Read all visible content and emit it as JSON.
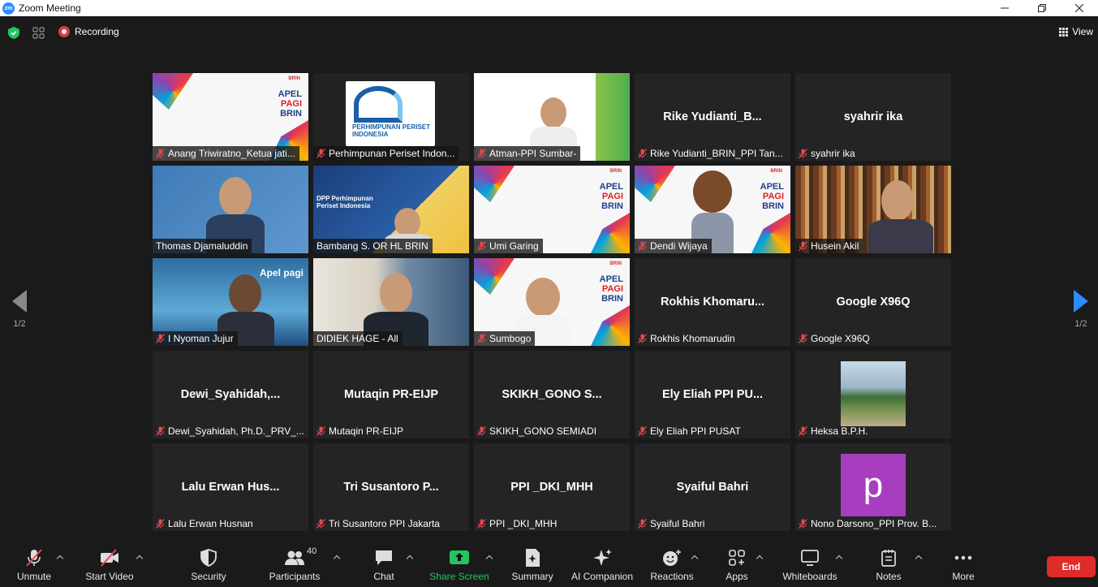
{
  "window": {
    "title": "Zoom Meeting",
    "logo_text": "zm"
  },
  "topbar": {
    "recording_label": "Recording",
    "view_label": "View"
  },
  "pager": {
    "left": "1/2",
    "right": "1/2"
  },
  "tiles": [
    {
      "name": "Anang Triwiratno_Ketua jati...",
      "kind": "apel",
      "muted": true
    },
    {
      "name": "Perhimpunan Periset Indon...",
      "kind": "ppi",
      "muted": true
    },
    {
      "name": "Atman-PPI Sumbar-",
      "kind": "sumbar",
      "muted": true
    },
    {
      "name": "Rike Yudianti_BRIN_PPI Tan...",
      "kind": "text",
      "display": "Rike  Yudianti_B...",
      "muted": true
    },
    {
      "name": "syahrir ika",
      "kind": "text",
      "display": "syahrir ika",
      "muted": true
    },
    {
      "name": "Thomas Djamaluddin",
      "kind": "thomas",
      "muted": false
    },
    {
      "name": "Bambang S. OR HL BRIN",
      "kind": "bambang",
      "muted": false
    },
    {
      "name": "Umi Garing",
      "kind": "apel",
      "muted": true
    },
    {
      "name": "Dendi Wijaya",
      "kind": "dendi",
      "muted": true
    },
    {
      "name": "Husein Akil",
      "kind": "husein",
      "muted": true
    },
    {
      "name": "I Nyoman Jujur",
      "kind": "nyoman",
      "muted": true
    },
    {
      "name": "DIDIEK HAGE - All",
      "kind": "didiek",
      "muted": false,
      "active": true
    },
    {
      "name": "Sumbogo",
      "kind": "sumbogo",
      "muted": true
    },
    {
      "name": "Rokhis Khomarudin",
      "kind": "text",
      "display": "Rokhis  Khomaru...",
      "muted": true
    },
    {
      "name": "Google X96Q",
      "kind": "text",
      "display": "Google X96Q",
      "muted": true
    },
    {
      "name": "Dewi_Syahidah, Ph.D._PRV_...",
      "kind": "text",
      "display": "Dewi_Syahidah,...",
      "muted": true
    },
    {
      "name": "Mutaqin PR-EIJP",
      "kind": "text",
      "display": "Mutaqin PR-EIJP",
      "muted": true
    },
    {
      "name": "SKIKH_GONO SEMIADI",
      "kind": "text",
      "display": "SKIKH_GONO  S...",
      "muted": true
    },
    {
      "name": "Ely Eliah  PPI PUSAT",
      "kind": "text",
      "display": "Ely Eliah   PPI PU...",
      "muted": true
    },
    {
      "name": "Heksa B.P.H.",
      "kind": "photo",
      "muted": true
    },
    {
      "name": "Lalu Erwan Husnan",
      "kind": "text",
      "display": "Lalu  Erwan Hus...",
      "muted": true
    },
    {
      "name": "Tri Susantoro PPI Jakarta",
      "kind": "text",
      "display": "Tri Susantoro  P...",
      "muted": true
    },
    {
      "name": "PPI _DKI_MHH",
      "kind": "text",
      "display": "PPI _DKI_MHH",
      "muted": true
    },
    {
      "name": "Syaiful Bahri",
      "kind": "text",
      "display": "Syaiful Bahri",
      "muted": true
    },
    {
      "name": "Nono Darsono_PPI Prov. B...",
      "kind": "avatar",
      "avatar_letter": "p",
      "muted": true
    }
  ],
  "tile_art": {
    "apel_line1": "APEL",
    "apel_line2": "PAGI",
    "apel_line3": "BRIN",
    "brin": "BRIN",
    "ppi_text": "PERHIMPUNAN PERISET INDONESIA",
    "dpp_text": "DPP Perhimpunan Periset Indonesia",
    "apel_pagi": "Apel pagi"
  },
  "toolbar": {
    "unmute": "Unmute",
    "start_video": "Start Video",
    "security": "Security",
    "participants": "Participants",
    "participants_count": "40",
    "chat": "Chat",
    "share_screen": "Share Screen",
    "summary": "Summary",
    "ai_companion": "AI Companion",
    "reactions": "Reactions",
    "apps": "Apps",
    "whiteboards": "Whiteboards",
    "notes": "Notes",
    "more": "More",
    "end": "End"
  },
  "colors": {
    "accent": "#2d8cff",
    "share_green": "#22c55e",
    "end_red": "#e02b2b",
    "active_border": "#e8e26a",
    "mute_red": "#e5484d"
  }
}
